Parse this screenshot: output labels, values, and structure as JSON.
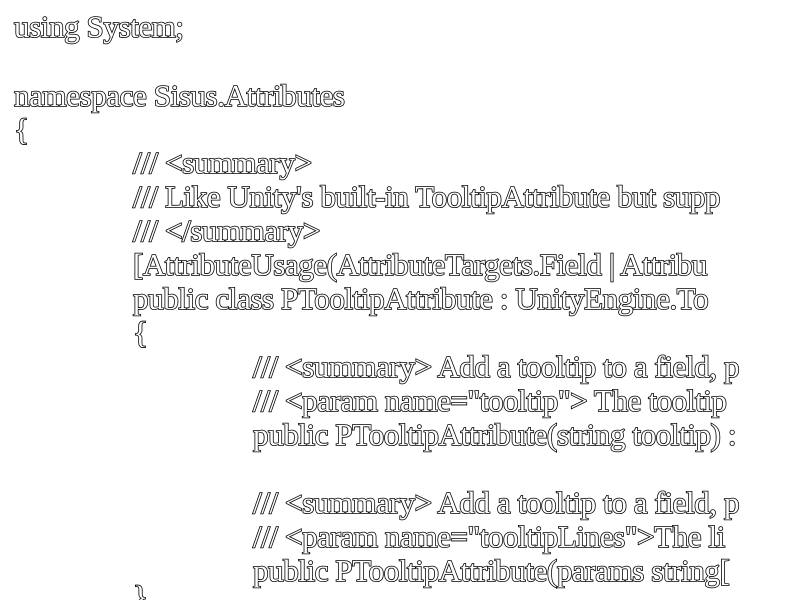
{
  "code_lines": [
    "using System;",
    "",
    "namespace Sisus.Attributes",
    "{",
    "/// <summary>",
    "/// Like Unity's built-in TooltipAttribute but supp",
    "/// </summary>",
    "[AttributeUsage(AttributeTargets.Field | Attribu",
    "public class PTooltipAttribute : UnityEngine.To",
    "{",
    "/// <summary> Add a tooltip to a field, p",
    "/// <param name=\"tooltip\"> The tooltip",
    "public PTooltipAttribute(string tooltip) :",
    "",
    "/// <summary> Add a tooltip to a field, p",
    "/// <param name=\"tooltipLines\">The li",
    "public PTooltipAttribute(params string[",
    "}"
  ]
}
